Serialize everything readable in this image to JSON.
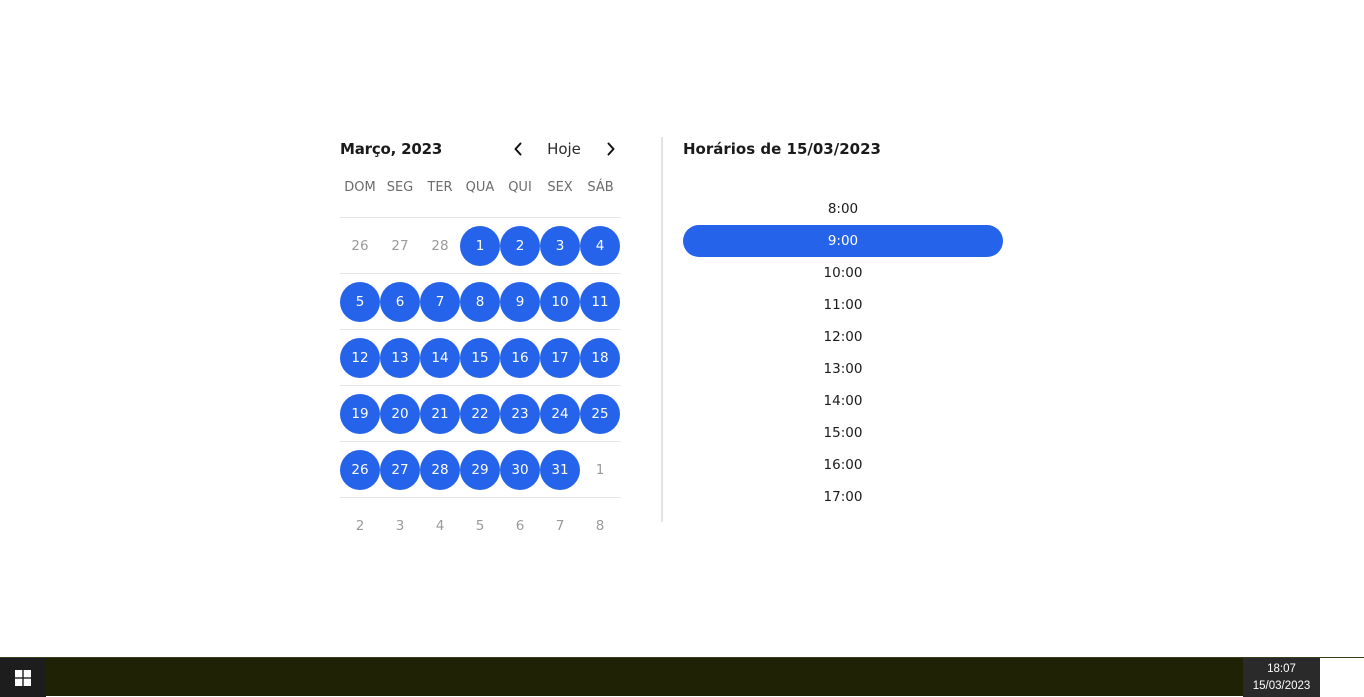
{
  "calendar": {
    "month_title": "Março, 2023",
    "today_label": "Hoje",
    "weekdays": [
      "DOM",
      "SEG",
      "TER",
      "QUA",
      "QUI",
      "SEX",
      "SÁB"
    ],
    "weeks": [
      [
        {
          "d": "26",
          "a": false
        },
        {
          "d": "27",
          "a": false
        },
        {
          "d": "28",
          "a": false
        },
        {
          "d": "1",
          "a": true
        },
        {
          "d": "2",
          "a": true
        },
        {
          "d": "3",
          "a": true
        },
        {
          "d": "4",
          "a": true
        }
      ],
      [
        {
          "d": "5",
          "a": true
        },
        {
          "d": "6",
          "a": true
        },
        {
          "d": "7",
          "a": true
        },
        {
          "d": "8",
          "a": true
        },
        {
          "d": "9",
          "a": true
        },
        {
          "d": "10",
          "a": true
        },
        {
          "d": "11",
          "a": true
        }
      ],
      [
        {
          "d": "12",
          "a": true
        },
        {
          "d": "13",
          "a": true
        },
        {
          "d": "14",
          "a": true
        },
        {
          "d": "15",
          "a": true
        },
        {
          "d": "16",
          "a": true
        },
        {
          "d": "17",
          "a": true
        },
        {
          "d": "18",
          "a": true
        }
      ],
      [
        {
          "d": "19",
          "a": true
        },
        {
          "d": "20",
          "a": true
        },
        {
          "d": "21",
          "a": true
        },
        {
          "d": "22",
          "a": true
        },
        {
          "d": "23",
          "a": true
        },
        {
          "d": "24",
          "a": true
        },
        {
          "d": "25",
          "a": true
        }
      ],
      [
        {
          "d": "26",
          "a": true
        },
        {
          "d": "27",
          "a": true
        },
        {
          "d": "28",
          "a": true
        },
        {
          "d": "29",
          "a": true
        },
        {
          "d": "30",
          "a": true
        },
        {
          "d": "31",
          "a": true
        },
        {
          "d": "1",
          "a": false
        }
      ],
      [
        {
          "d": "2",
          "a": false
        },
        {
          "d": "3",
          "a": false
        },
        {
          "d": "4",
          "a": false
        },
        {
          "d": "5",
          "a": false
        },
        {
          "d": "6",
          "a": false
        },
        {
          "d": "7",
          "a": false
        },
        {
          "d": "8",
          "a": false
        }
      ]
    ]
  },
  "times": {
    "title": "Horários de 15/03/2023",
    "selected": "9:00",
    "slots": [
      "8:00",
      "9:00",
      "10:00",
      "11:00",
      "12:00",
      "13:00",
      "14:00",
      "15:00",
      "16:00",
      "17:00"
    ]
  },
  "taskbar": {
    "time": "18:07",
    "date": "15/03/2023"
  },
  "colors": {
    "accent": "#2563eb",
    "taskbar": "#1f2204"
  },
  "icons": {
    "prev": "chevron-left-icon",
    "next": "chevron-right-icon",
    "start": "windows-logo-icon"
  }
}
